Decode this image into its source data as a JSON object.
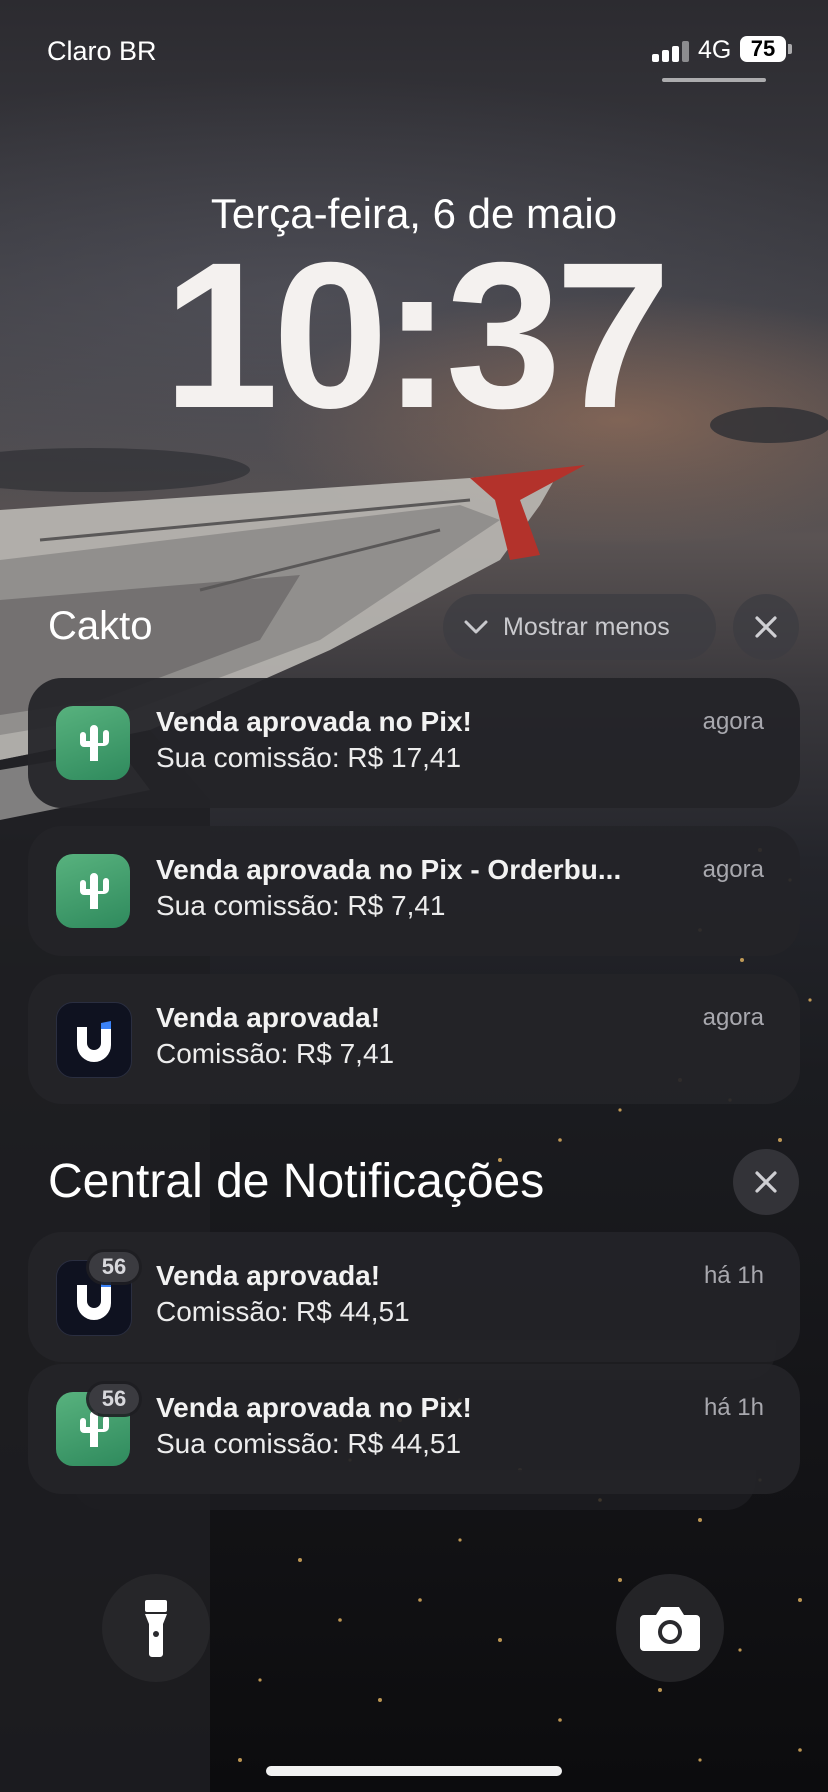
{
  "status_bar": {
    "carrier": "Claro BR",
    "network": "4G",
    "battery": "75"
  },
  "lock_screen": {
    "date": "Terça-feira, 6 de maio",
    "time": "10:37"
  },
  "cakto_group": {
    "title": "Cakto",
    "show_less_label": "Mostrar menos",
    "notifications": [
      {
        "app": "cakto",
        "title": "Venda aprovada no Pix!",
        "body": "Sua comissão: R$ 17,41",
        "time": "agora"
      },
      {
        "app": "cakto",
        "title": "Venda aprovada no Pix - Orderbu...",
        "body": "Sua comissão: R$ 7,41",
        "time": "agora"
      },
      {
        "app": "u-app",
        "title": "Venda aprovada!",
        "body": "Comissão: R$ 7,41",
        "time": "agora"
      }
    ]
  },
  "notification_center": {
    "title": "Central de Notificações",
    "notifications": [
      {
        "app": "u-app",
        "badge": "56",
        "title": "Venda aprovada!",
        "body": "Comissão: R$ 44,51",
        "time": "há 1h"
      },
      {
        "app": "cakto",
        "badge": "56",
        "title": "Venda aprovada no Pix!",
        "body": "Sua comissão: R$ 44,51",
        "time": "há 1h"
      }
    ]
  },
  "icons": {
    "chevron": "chevron-down-icon",
    "close": "close-icon",
    "flashlight": "flashlight-icon",
    "camera": "camera-icon",
    "cakto_app": "cactus-icon",
    "u_app": "u-logo-icon"
  },
  "colors": {
    "cakto_icon": "#3f9a6b",
    "card_bg": "#242428",
    "u_app_icon": "#0f1220"
  }
}
